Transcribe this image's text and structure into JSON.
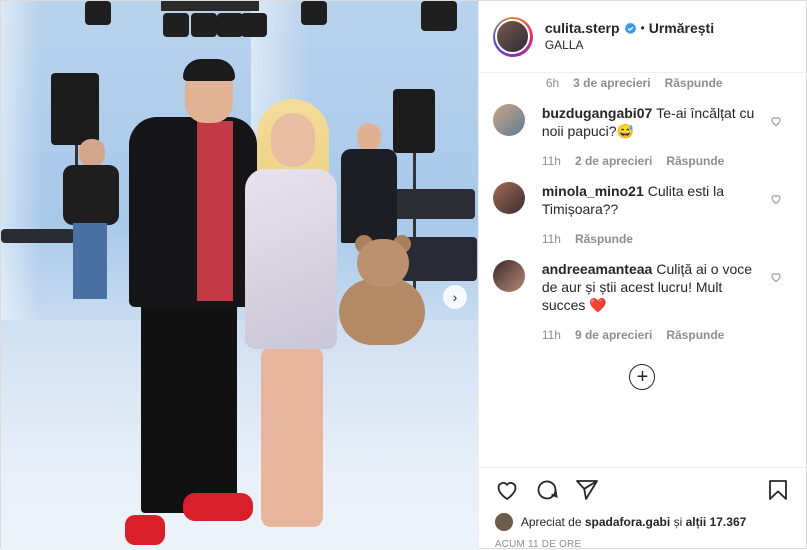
{
  "post": {
    "username": "culita.sterp",
    "follow_label": "Urmărești",
    "location": "GALLA",
    "separator": "•"
  },
  "comments": {
    "first_meta": {
      "time": "6h",
      "likes": "3 de aprecieri",
      "reply": "Răspunde"
    },
    "items": [
      {
        "username": "buzdugangabi07",
        "text": "Te-ai încălțat cu noii papuci?😅",
        "time": "11h",
        "likes": "2 de aprecieri",
        "reply": "Răspunde"
      },
      {
        "username": "minola_mino21",
        "text": "Culita esti la Timișoara??",
        "time": "11h",
        "likes": "",
        "reply": "Răspunde"
      },
      {
        "username": "andreeamanteaa",
        "text": "Culiță ai o voce de aur și știi acest lucru! Mult succes ❤️",
        "time": "11h",
        "likes": "9 de aprecieri",
        "reply": "Răspunde"
      }
    ],
    "load_more_icon": "plus-circle"
  },
  "likes": {
    "prefix": "Apreciat de",
    "liker": "spadafora.gabi",
    "middle": "și",
    "others": "alții 17.367"
  },
  "timestamp": "ACUM 11 DE ORE",
  "icons": {
    "like": "heart-icon",
    "comment": "comment-icon",
    "share": "share-icon",
    "save": "bookmark-icon",
    "verified": "verified-badge-icon"
  },
  "colors": {
    "verified": "#3897f0",
    "text": "#262626",
    "muted": "#8e8e8e",
    "border": "#efefef"
  }
}
